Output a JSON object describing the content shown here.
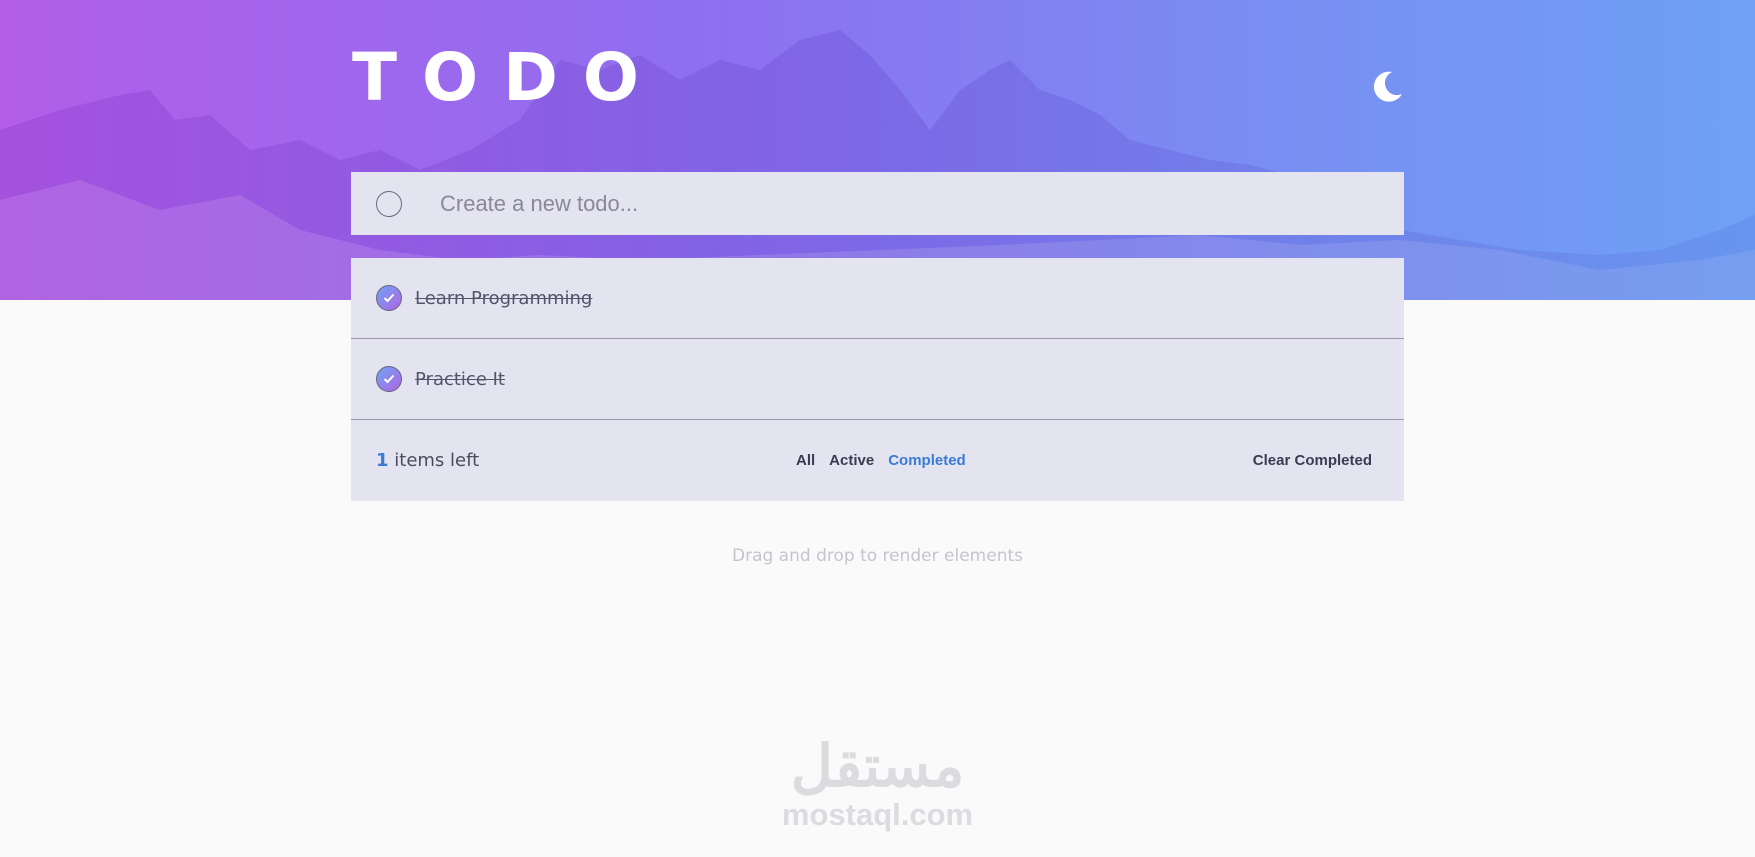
{
  "app": {
    "title": "TODO"
  },
  "header": {
    "theme_toggle_icon": "moon-icon"
  },
  "new_todo": {
    "placeholder": "Create a new todo..."
  },
  "todos": [
    {
      "text": "Learn Programming",
      "completed": true
    },
    {
      "text": "Practice It",
      "completed": true
    }
  ],
  "footer": {
    "items_left_count": "1",
    "items_left_label": "items left",
    "filters": {
      "all": "All",
      "active": "Active",
      "completed": "Completed",
      "selected": "Completed"
    },
    "clear_completed": "Clear Completed"
  },
  "hint": "Drag and drop to render elements",
  "watermark": {
    "arabic": "مستقل",
    "latin": "mostaql.com"
  },
  "colors": {
    "accent": "#3a7bd5",
    "card_bg": "#e4e4f1",
    "gradient_start": "#b25ee8",
    "gradient_end": "#6ea1f5"
  }
}
